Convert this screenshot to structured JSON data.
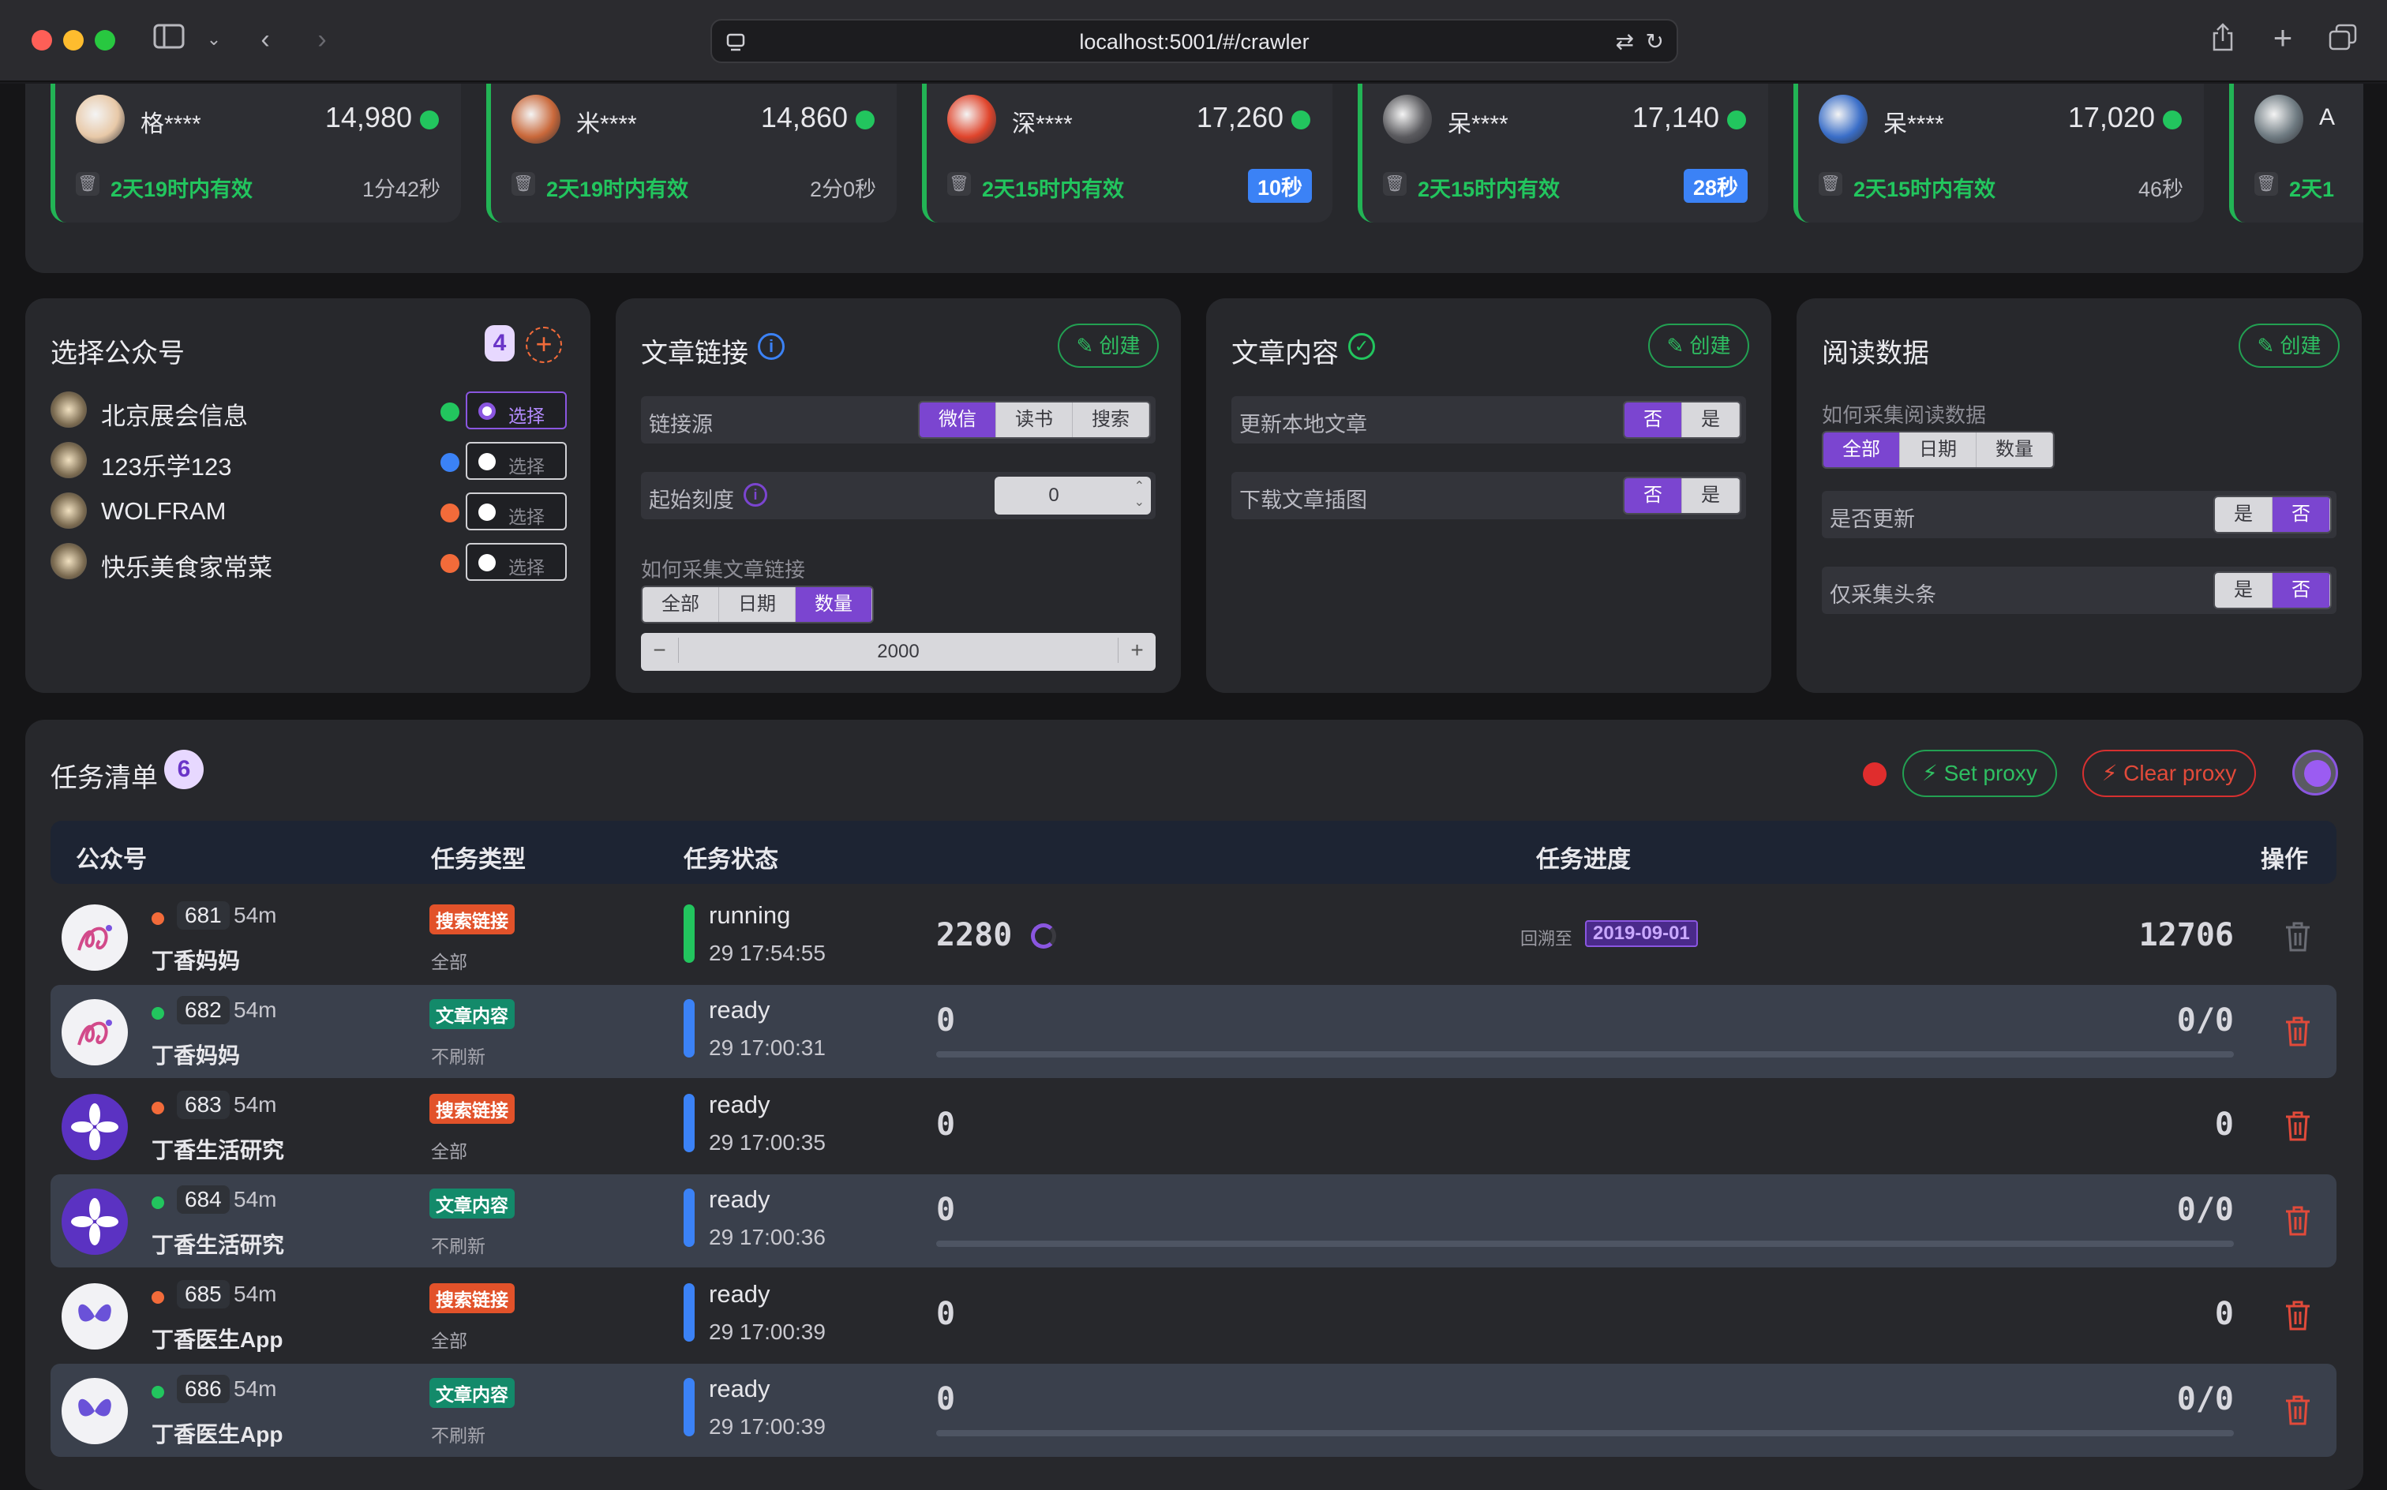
{
  "browser": {
    "url": "localhost:5001/#/crawler"
  },
  "accounts": [
    {
      "name": "格****",
      "score": "14,980",
      "valid": "2天19时内有效",
      "time": "1分42秒",
      "badge": false,
      "avatar_color": "#e8c9a8"
    },
    {
      "name": "米****",
      "score": "14,860",
      "valid": "2天19时内有效",
      "time": "2分0秒",
      "badge": false,
      "avatar_color": "#c9683a"
    },
    {
      "name": "深****",
      "score": "17,260",
      "valid": "2天15时内有效",
      "time": "10秒",
      "badge": true,
      "avatar_color": "#e0452c"
    },
    {
      "name": "呆****",
      "score": "17,140",
      "valid": "2天15时内有效",
      "time": "28秒",
      "badge": true,
      "avatar_color": "#5a5a5e"
    },
    {
      "name": "呆****",
      "score": "17,020",
      "valid": "2天15时内有效",
      "time": "46秒",
      "badge": false,
      "avatar_color": "#3a6ec8"
    },
    {
      "name": "A",
      "score": "",
      "valid": "2天1",
      "time": "",
      "badge": false,
      "avatar_color": "#6f7b82"
    }
  ],
  "select_panel": {
    "title": "选择公众号",
    "count": "4",
    "add_icon": "plus-circle-icon",
    "items": [
      {
        "name": "北京展会信息",
        "dot": "#22c55e",
        "label": "选择",
        "selected": true
      },
      {
        "name": "123乐学123",
        "dot": "#3b82f6",
        "label": "选择",
        "selected": false
      },
      {
        "name": "WOLFRAM",
        "dot": "#f26b3a",
        "label": "选择",
        "selected": false
      },
      {
        "name": "快乐美食家常菜",
        "dot": "#f26b3a",
        "label": "选择",
        "selected": false
      }
    ]
  },
  "link_panel": {
    "title": "文章链接",
    "create": "创建",
    "source_label": "链接源",
    "source_options": [
      "微信",
      "读书",
      "搜索"
    ],
    "source_selected": 0,
    "start_label": "起始刻度",
    "start_value": "0",
    "how_label": "如何采集文章链接",
    "how_options": [
      "全部",
      "日期",
      "数量"
    ],
    "how_selected": 2,
    "count_value": "2000",
    "minus": "−",
    "plus": "+"
  },
  "content_panel": {
    "title": "文章内容",
    "create": "创建",
    "rows": [
      {
        "label": "更新本地文章",
        "options": [
          "否",
          "是"
        ],
        "selected": 0
      },
      {
        "label": "下载文章插图",
        "options": [
          "否",
          "是"
        ],
        "selected": 0
      }
    ]
  },
  "read_panel": {
    "title": "阅读数据",
    "create": "创建",
    "how_label": "如何采集阅读数据",
    "how_options": [
      "全部",
      "日期",
      "数量"
    ],
    "how_selected": 0,
    "rows": [
      {
        "label": "是否更新",
        "options": [
          "是",
          "否"
        ],
        "selected": 1
      },
      {
        "label": "仅采集头条",
        "options": [
          "是",
          "否"
        ],
        "selected": 1
      }
    ]
  },
  "tasks": {
    "title": "任务清单",
    "count": "6",
    "set_proxy": "Set proxy",
    "clear_proxy": "Clear proxy",
    "headers": {
      "account": "公众号",
      "type": "任务类型",
      "status": "任务状态",
      "progress": "任务进度",
      "ops": "操作"
    },
    "rows": [
      {
        "id": "681",
        "age": "54m",
        "name": "丁香妈妈",
        "type": "搜索链接",
        "type_color": "#e2522a",
        "sub": "全部",
        "status": "running",
        "time": "29 17:54:55",
        "bar": "#22c55e",
        "count": "2280",
        "spinner": true,
        "back_label": "回溯至",
        "back_date": "2019-09-01",
        "total": "12706",
        "progress": false,
        "dot": "#f26b3a",
        "delete_color": "#6a6c74",
        "alt": false,
        "avatar": "spiral"
      },
      {
        "id": "682",
        "age": "54m",
        "name": "丁香妈妈",
        "type": "文章内容",
        "type_color": "#138a6a",
        "sub": "不刷新",
        "status": "ready",
        "time": "29 17:00:31",
        "bar": "#3b82f6",
        "count": "0",
        "spinner": false,
        "back_label": "",
        "back_date": "",
        "total": "0/0",
        "progress": true,
        "dot": "#22c55e",
        "delete_color": "#e24a3a",
        "alt": true,
        "avatar": "spiral"
      },
      {
        "id": "683",
        "age": "54m",
        "name": "丁香生活研究",
        "type": "搜索链接",
        "type_color": "#e2522a",
        "sub": "全部",
        "status": "ready",
        "time": "29 17:00:35",
        "bar": "#3b82f6",
        "count": "0",
        "spinner": false,
        "back_label": "",
        "back_date": "",
        "total": "0",
        "progress": false,
        "dot": "#f26b3a",
        "delete_color": "#e24a3a",
        "alt": false,
        "avatar": "flower"
      },
      {
        "id": "684",
        "age": "54m",
        "name": "丁香生活研究",
        "type": "文章内容",
        "type_color": "#138a6a",
        "sub": "不刷新",
        "status": "ready",
        "time": "29 17:00:36",
        "bar": "#3b82f6",
        "count": "0",
        "spinner": false,
        "back_label": "",
        "back_date": "",
        "total": "0/0",
        "progress": true,
        "dot": "#22c55e",
        "delete_color": "#e24a3a",
        "alt": true,
        "avatar": "flower"
      },
      {
        "id": "685",
        "age": "54m",
        "name": "丁香医生App",
        "type": "搜索链接",
        "type_color": "#e2522a",
        "sub": "全部",
        "status": "ready",
        "time": "29 17:00:39",
        "bar": "#3b82f6",
        "count": "0",
        "spinner": false,
        "back_label": "",
        "back_date": "",
        "total": "0",
        "progress": false,
        "dot": "#f26b3a",
        "delete_color": "#e24a3a",
        "alt": false,
        "avatar": "butterfly"
      },
      {
        "id": "686",
        "age": "54m",
        "name": "丁香医生App",
        "type": "文章内容",
        "type_color": "#138a6a",
        "sub": "不刷新",
        "status": "ready",
        "time": "29 17:00:39",
        "bar": "#3b82f6",
        "count": "0",
        "spinner": false,
        "back_label": "",
        "back_date": "",
        "total": "0/0",
        "progress": true,
        "dot": "#22c55e",
        "delete_color": "#e24a3a",
        "alt": true,
        "avatar": "butterfly"
      }
    ]
  },
  "colors": {
    "accent": "#7b45d0",
    "green": "#22c55e",
    "red": "#e24a3a",
    "blue": "#3b82f6"
  }
}
